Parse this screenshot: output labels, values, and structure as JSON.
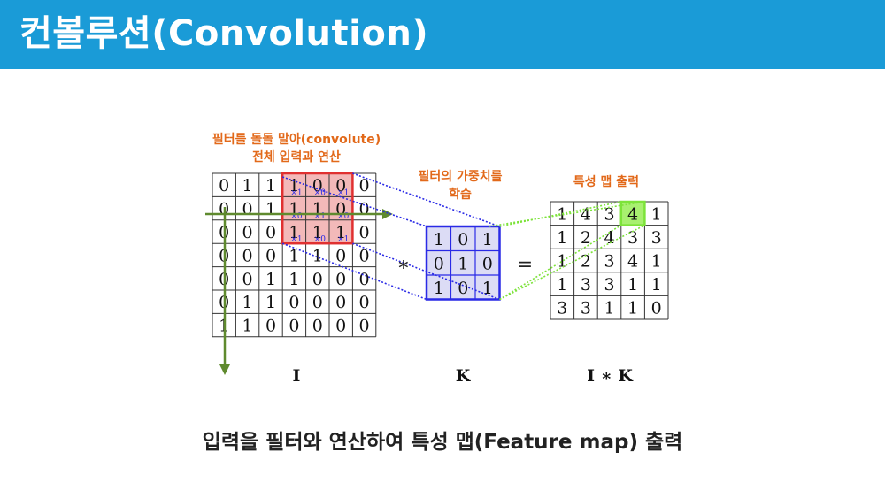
{
  "slide": {
    "title": "컨볼루션(Convolution)",
    "caption": "입력을 필터와 연산하여 특성 맵(Feature map) 출력"
  },
  "annotations": {
    "filter_slide_line1": "필터를 돌돌 말아(convolute)",
    "filter_slide_line2": "전체 입력과 연산",
    "filter_weights_line1": "필터의 가중치를",
    "filter_weights_line2": "학습",
    "feature_map_output": "특성 맵 출력"
  },
  "diagram": {
    "input_label": "I",
    "kernel_label": "K",
    "output_label": "I ∗ K",
    "op_star": "∗",
    "op_equals": "=",
    "input_matrix": [
      [
        0,
        1,
        1,
        1,
        0,
        0,
        0
      ],
      [
        0,
        0,
        1,
        1,
        1,
        0,
        0
      ],
      [
        0,
        0,
        0,
        1,
        1,
        1,
        0
      ],
      [
        0,
        0,
        0,
        1,
        1,
        0,
        0
      ],
      [
        0,
        0,
        1,
        1,
        0,
        0,
        0
      ],
      [
        0,
        1,
        1,
        0,
        0,
        0,
        0
      ],
      [
        1,
        1,
        0,
        0,
        0,
        0,
        0
      ]
    ],
    "kernel_matrix": [
      [
        1,
        0,
        1
      ],
      [
        0,
        1,
        0
      ],
      [
        1,
        0,
        1
      ]
    ],
    "window_multipliers": [
      [
        "×1",
        "×0",
        "×1"
      ],
      [
        "×0",
        "×1",
        "×0"
      ],
      [
        "×1",
        "×0",
        "×1"
      ]
    ],
    "output_matrix": [
      [
        1,
        4,
        3,
        4,
        1
      ],
      [
        1,
        2,
        4,
        3,
        3
      ],
      [
        1,
        2,
        3,
        4,
        1
      ],
      [
        1,
        3,
        3,
        1,
        1
      ],
      [
        3,
        3,
        1,
        1,
        0
      ]
    ],
    "highlight_output_cell": [
      0,
      3
    ],
    "colors": {
      "window_fill": "#f3b9b9",
      "window_border": "#e03030",
      "kernel_fill": "#dcdcf5",
      "kernel_border": "#2a2ae6",
      "blue_dots": "#2a2ae6",
      "green_dots": "#7de33a",
      "output_highlight": "#a8f070",
      "axis_arrow": "#5f8a2e",
      "annotation": "#e2691a"
    }
  }
}
